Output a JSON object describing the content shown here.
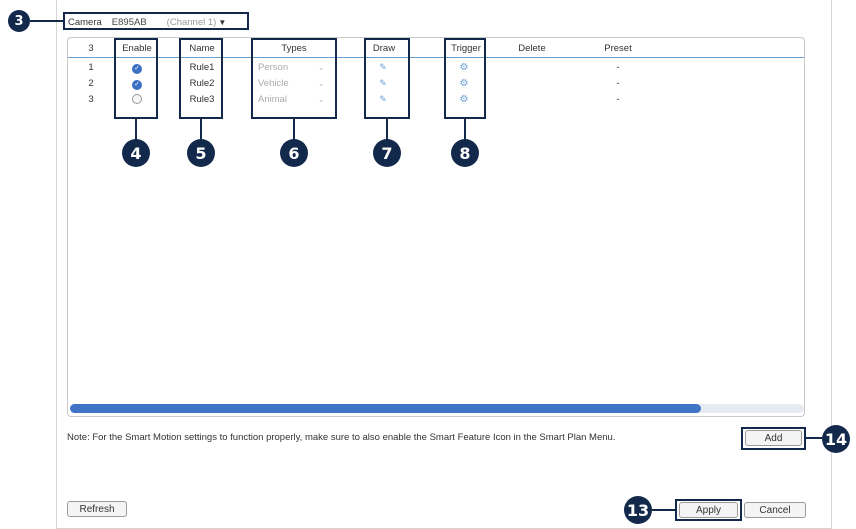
{
  "camera": {
    "label": "Camera",
    "value": "E895AB",
    "channel": "(Channel 1)"
  },
  "table": {
    "headers": [
      "3",
      "Enable",
      "Name",
      "Types",
      "Draw",
      "Trigger",
      "Delete",
      "Preset"
    ],
    "rows": [
      {
        "index": "1",
        "enabled": true,
        "name": "Rule1",
        "type": "Person",
        "preset": "-"
      },
      {
        "index": "2",
        "enabled": true,
        "name": "Rule2",
        "type": "Vehicle",
        "preset": "-"
      },
      {
        "index": "3",
        "enabled": false,
        "name": "Rule3",
        "type": "Animal",
        "preset": "-"
      }
    ],
    "scroll_fraction": 0.86
  },
  "callouts": {
    "c3": "3",
    "c4": "4",
    "c5": "5",
    "c6": "6",
    "c7": "7",
    "c8": "8",
    "c13": "13",
    "c14": "14"
  },
  "buttons": {
    "add": "Add",
    "refresh": "Refresh",
    "apply": "Apply",
    "cancel": "Cancel"
  },
  "note": "Note: For the Smart Motion settings to function properly, make sure to also enable the Smart Feature Icon in the Smart Plan Menu.",
  "icons": {
    "check": "check-icon",
    "pencil": "pencil-icon",
    "gear": "gear-icon",
    "chevron": "chevron-down-icon"
  },
  "colors": {
    "callout": "#13294b",
    "accent": "#3f74c7"
  }
}
